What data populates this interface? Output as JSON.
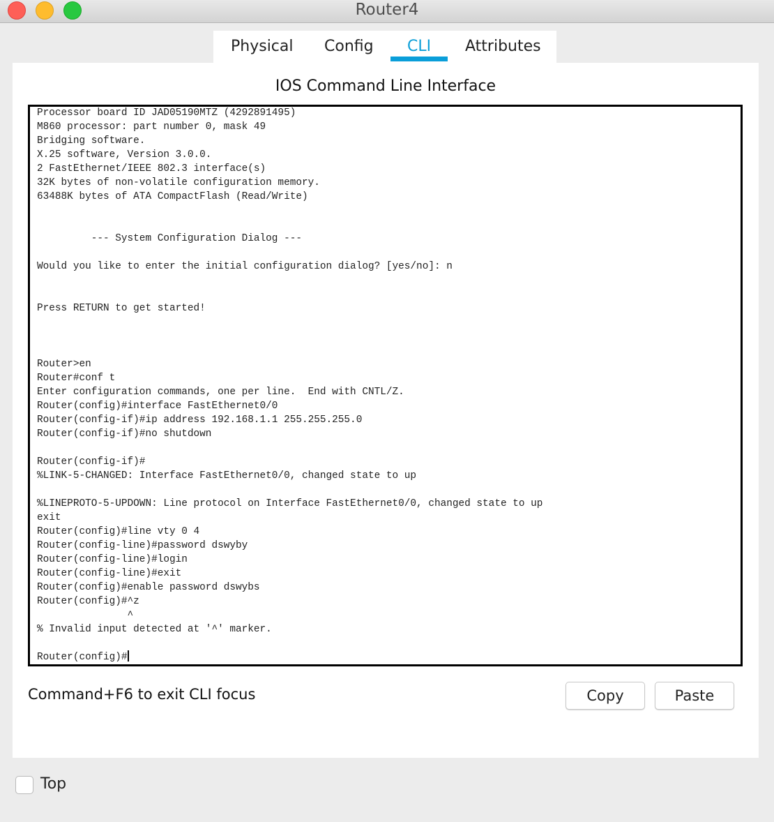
{
  "window": {
    "title": "Router4"
  },
  "tabs": [
    {
      "label": "Physical",
      "active": false
    },
    {
      "label": "Config",
      "active": false
    },
    {
      "label": "CLI",
      "active": true
    },
    {
      "label": "Attributes",
      "active": false
    }
  ],
  "accent_color": "#0a9ed9",
  "panel": {
    "title": "IOS Command Line Interface"
  },
  "cli": {
    "lines": [
      "Processor board ID JAD05190MTZ (4292891495)",
      "M860 processor: part number 0, mask 49",
      "Bridging software.",
      "X.25 software, Version 3.0.0.",
      "2 FastEthernet/IEEE 802.3 interface(s)",
      "32K bytes of non-volatile configuration memory.",
      "63488K bytes of ATA CompactFlash (Read/Write)",
      "",
      "",
      "         --- System Configuration Dialog ---",
      "",
      "Would you like to enter the initial configuration dialog? [yes/no]: n",
      "",
      "",
      "Press RETURN to get started!",
      "",
      "",
      "",
      "Router>en",
      "Router#conf t",
      "Enter configuration commands, one per line.  End with CNTL/Z.",
      "Router(config)#interface FastEthernet0/0",
      "Router(config-if)#ip address 192.168.1.1 255.255.255.0",
      "Router(config-if)#no shutdown",
      "",
      "Router(config-if)#",
      "%LINK-5-CHANGED: Interface FastEthernet0/0, changed state to up",
      "",
      "%LINEPROTO-5-UPDOWN: Line protocol on Interface FastEthernet0/0, changed state to up",
      "exit",
      "Router(config)#line vty 0 4",
      "Router(config-line)#password dswyby",
      "Router(config-line)#login",
      "Router(config-line)#exit",
      "Router(config)#enable password dswybs",
      "Router(config)#^z",
      "               ^",
      "% Invalid input detected at '^' marker.",
      ""
    ],
    "prompt": "Router(config)#"
  },
  "footer": {
    "hint": "Command+F6 to exit CLI focus",
    "copy_label": "Copy",
    "paste_label": "Paste"
  },
  "top_checkbox": {
    "label": "Top",
    "checked": false
  }
}
